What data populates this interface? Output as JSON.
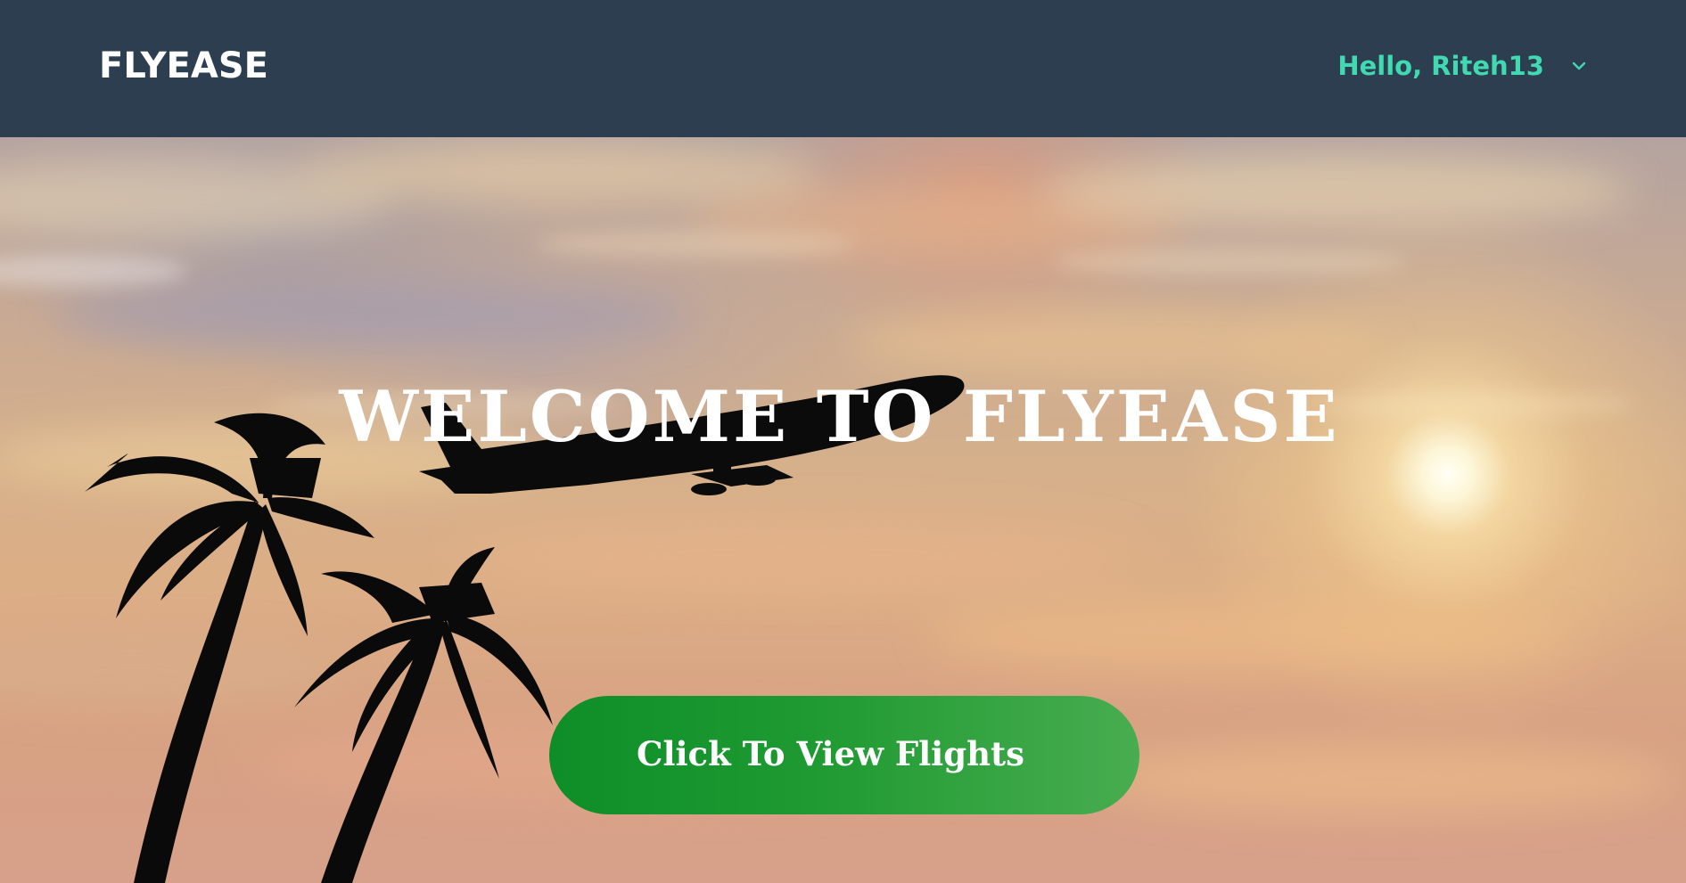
{
  "header": {
    "brand": "FLYEASE",
    "greeting": "Hello, Riteh13",
    "menu_icon": "chevron-down-icon"
  },
  "hero": {
    "title": "WELCOME TO FLYEASE",
    "cta_label": "Click To View Flights",
    "image_elements": [
      "airplane-silhouette",
      "palm-trees-silhouette",
      "sun",
      "clouds"
    ]
  },
  "colors": {
    "navbar_bg": "#2d3e50",
    "brand_text": "#ffffff",
    "greeting_text": "#40d9b2",
    "cta_start": "#0e8e28",
    "cta_end": "#48ad50"
  }
}
